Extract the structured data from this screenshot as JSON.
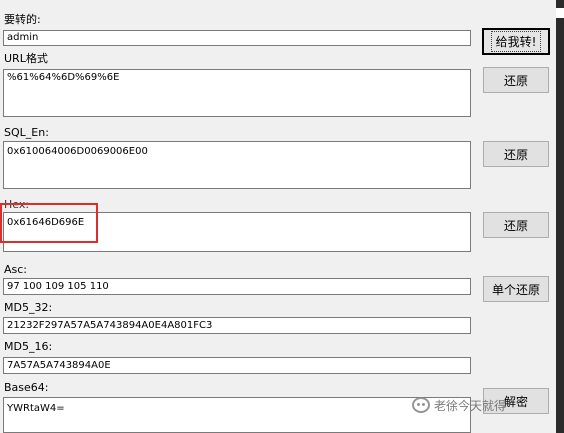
{
  "fields": {
    "input": {
      "label": "要转的:",
      "value": "admin"
    },
    "url": {
      "label": "URL格式",
      "value": "%61%64%6D%69%6E"
    },
    "sql_en": {
      "label": "SQL_En:",
      "value": "0x610064006D0069006E00"
    },
    "hex": {
      "label": "Hex:",
      "value": "0x61646D696E"
    },
    "asc": {
      "label": "Asc:",
      "value": "97 100 109 105 110"
    },
    "md5_32": {
      "label": "MD5_32:",
      "value": "21232F297A57A5A743894A0E4A801FC3"
    },
    "md5_16": {
      "label": "MD5_16:",
      "value": "7A57A5A743894A0E"
    },
    "base64": {
      "label": "Base64:",
      "value": "YWRtaW4="
    }
  },
  "buttons": {
    "convert": "给我转!",
    "restore_url": "还原",
    "restore_sql": "还原",
    "restore_hex": "还原",
    "restore_single": "单个还原",
    "decode": "解密"
  },
  "watermark": {
    "text": "老徐今天就得",
    "icon": "wechat-icon"
  },
  "colors": {
    "highlight_box": "#d9302c",
    "background": "#f0f0f0"
  }
}
